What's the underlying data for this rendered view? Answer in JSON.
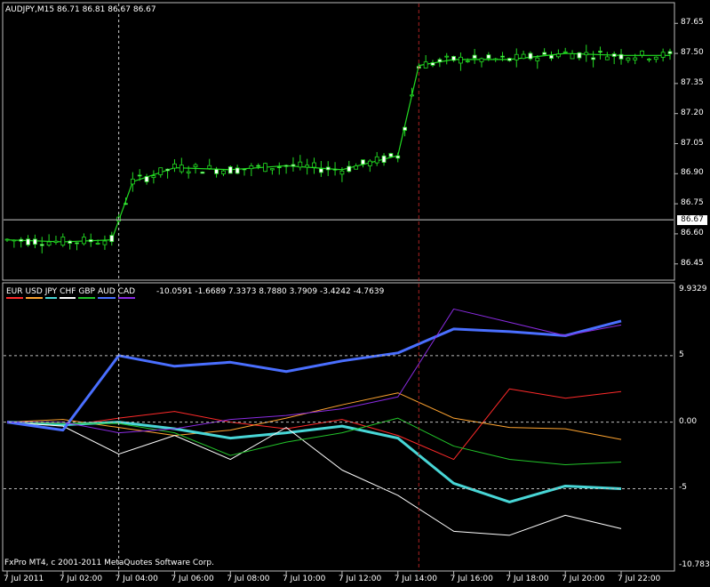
{
  "price_panel": {
    "header": "AUDJPY,M15  86.71 86.81 86.67 86.67",
    "current_price_label": "86.67",
    "axis_labels": [
      "87.65",
      "87.50",
      "87.35",
      "87.20",
      "87.05",
      "86.90",
      "86.75",
      "86.60",
      "86.45"
    ]
  },
  "indicator_panel": {
    "legend_labels": [
      "EUR",
      "USD",
      "JPY",
      "CHF",
      "GBP",
      "AUD",
      "CAD"
    ],
    "values_text": "-10.0591 -1.6689 7.3373 8.7880 3.7909 -3.4242 -4.7639",
    "axis_labels": [
      "9.9329",
      "5",
      "0.00",
      "-5",
      "-10.783"
    ]
  },
  "time_axis": [
    "7 Jul 2011",
    "7 Jul 02:00",
    "7 Jul 04:00",
    "7 Jul 06:00",
    "7 Jul 08:00",
    "7 Jul 10:00",
    "7 Jul 12:00",
    "7 Jul 14:00",
    "7 Jul 16:00",
    "7 Jul 18:00",
    "7 Jul 20:00",
    "7 Jul 22:00"
  ],
  "copyright": "FxPro MT4, c 2001-2011 MetaQuotes Software Corp.",
  "colors": {
    "EUR": "#ff2a2a",
    "USD": "#ffa430",
    "JPY": "#48d6d6",
    "CHF": "#ffffff",
    "GBP": "#22c42a",
    "AUD": "#4a6fff",
    "CAD": "#8a2be2",
    "price_line": "#22dd22",
    "grid": "#bbbbbb",
    "separator": "#aa2222"
  },
  "chart_data": [
    {
      "type": "line",
      "title": "AUDJPY,M15",
      "ylim": [
        86.4,
        87.7
      ],
      "series": [
        {
          "name": "AUDJPY",
          "x": [
            "00:00",
            "02:00",
            "03:45",
            "04:30",
            "06:00",
            "08:00",
            "10:00",
            "12:00",
            "14:00",
            "14:45",
            "16:00",
            "18:00",
            "20:00",
            "22:00",
            "23:45"
          ],
          "values": [
            86.57,
            86.56,
            86.57,
            86.86,
            86.93,
            86.92,
            86.94,
            86.92,
            86.99,
            87.44,
            87.47,
            87.47,
            87.5,
            87.49,
            87.49
          ]
        }
      ]
    },
    {
      "type": "line",
      "ylim": [
        -10.783,
        9.9329
      ],
      "x": [
        "00:00",
        "02:00",
        "04:00",
        "06:00",
        "08:00",
        "10:00",
        "12:00",
        "14:00",
        "16:00",
        "18:00",
        "20:00",
        "22:00"
      ],
      "series": [
        {
          "name": "EUR",
          "values": [
            0,
            -0.3,
            0.3,
            0.8,
            0.0,
            -0.5,
            0.2,
            -1.0,
            -2.8,
            2.5,
            1.8,
            2.3
          ]
        },
        {
          "name": "USD",
          "values": [
            0,
            0.2,
            -0.4,
            -1.0,
            -0.6,
            0.3,
            1.3,
            2.2,
            0.3,
            -0.4,
            -0.5,
            -1.3
          ]
        },
        {
          "name": "JPY",
          "values": [
            0,
            -0.2,
            0.0,
            -0.5,
            -1.2,
            -0.8,
            -0.3,
            -1.2,
            -4.6,
            -6.0,
            -4.8,
            -5.0
          ]
        },
        {
          "name": "CHF",
          "values": [
            0,
            -0.3,
            -2.4,
            -1.0,
            -2.8,
            -0.4,
            -3.6,
            -5.5,
            -8.2,
            -8.5,
            -7.0,
            -8.0
          ]
        },
        {
          "name": "GBP",
          "values": [
            0,
            -0.1,
            -0.1,
            -0.8,
            -2.5,
            -1.5,
            -0.8,
            0.3,
            -1.8,
            -2.8,
            -3.2,
            -3.0
          ]
        },
        {
          "name": "AUD",
          "values": [
            0,
            -0.6,
            5.0,
            4.2,
            4.5,
            3.8,
            4.6,
            5.2,
            7.0,
            6.8,
            6.5,
            7.6
          ]
        },
        {
          "name": "CAD",
          "values": [
            0,
            0.0,
            -0.8,
            -0.5,
            0.2,
            0.5,
            1.0,
            1.9,
            8.5,
            7.5,
            6.5,
            7.3
          ]
        }
      ]
    }
  ]
}
